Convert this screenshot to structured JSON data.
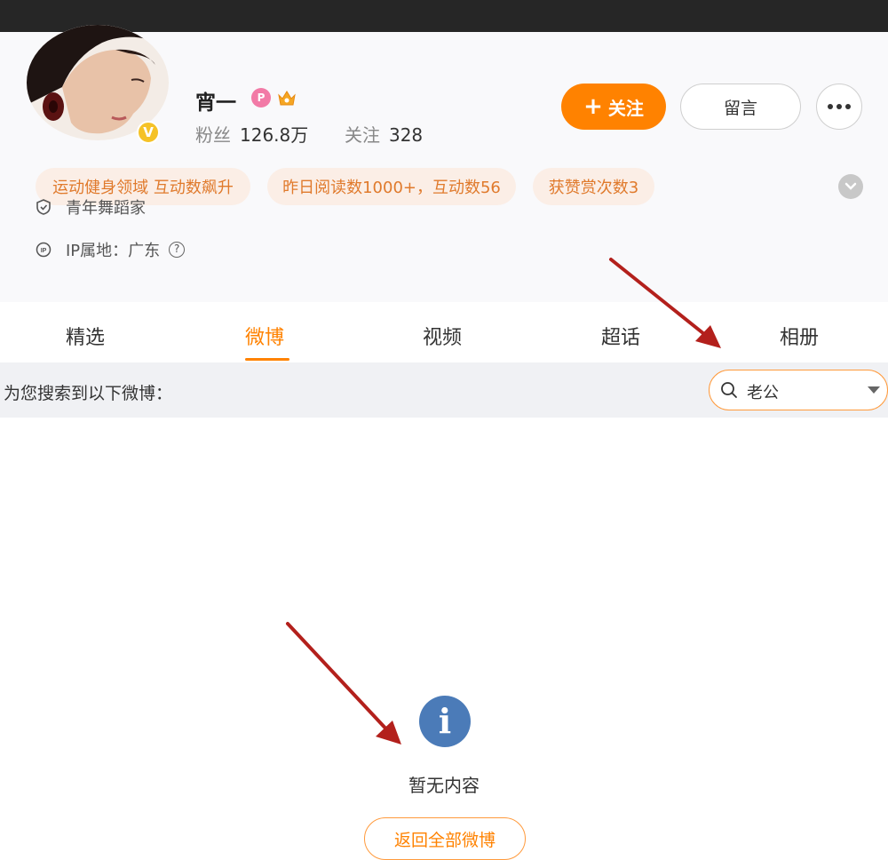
{
  "profile": {
    "name": "宵一",
    "svip_badge": "P",
    "verified_mark": "V",
    "fans_label": "粉丝",
    "fans_count": "126.8万",
    "following_label": "关注",
    "following_count": "328"
  },
  "actions": {
    "follow_label": "关注",
    "follow_plus": "+",
    "message_label": "留言"
  },
  "tags": [
    "运动健身领域 互动数飙升",
    "昨日阅读数1000+，互动数56",
    "获赞赏次数3"
  ],
  "info": {
    "title": "青年舞蹈家",
    "ip_label": "IP属地：广东",
    "ip_help": "?"
  },
  "tabs": [
    "精选",
    "微博",
    "视频",
    "超话",
    "相册"
  ],
  "active_tab": "微博",
  "search": {
    "caption": "为您搜索到以下微博：",
    "value": "老公"
  },
  "empty_state": {
    "icon_glyph": "i",
    "message": "暂无内容",
    "back_button_label": "返回全部微博"
  },
  "colors": {
    "accent": "#ff8200",
    "tag_text": "#e07a2c",
    "tag_bg": "#fbeee6",
    "info_icon": "#4b7bb8",
    "annotation_arrow": "#b3201c"
  },
  "icons": [
    "more-icon",
    "expand-chevron-icon",
    "shield-icon",
    "ip-icon",
    "search-icon",
    "dropdown-caret-icon",
    "info-icon",
    "annotation-arrow"
  ]
}
